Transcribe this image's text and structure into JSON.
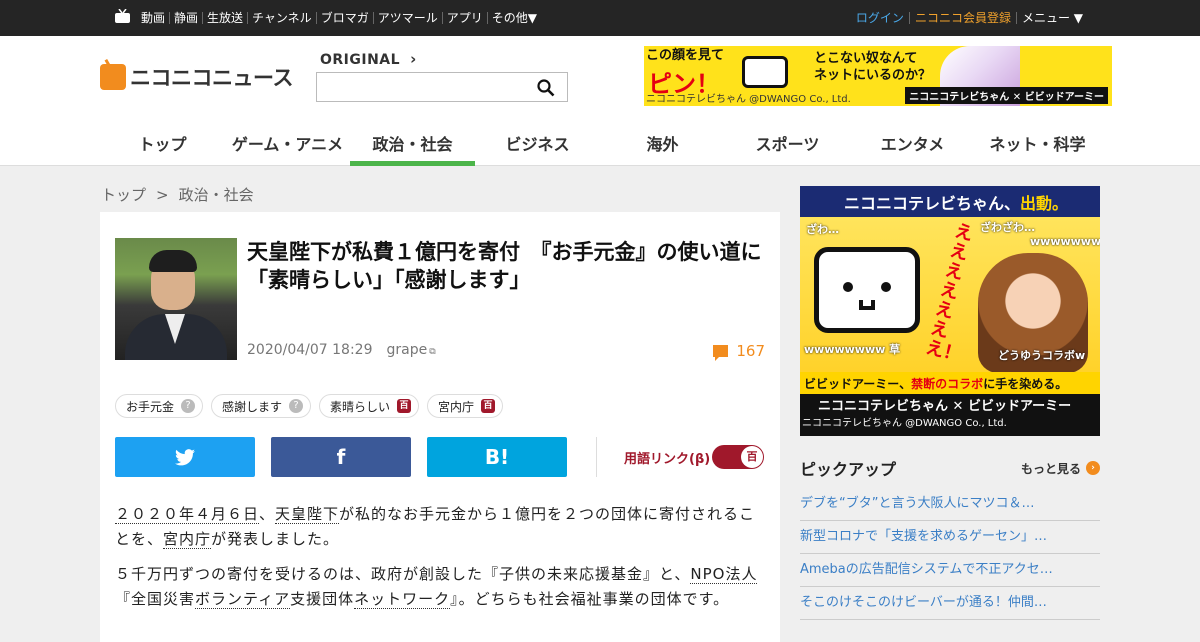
{
  "topbar": {
    "nav": [
      "動画",
      "静画",
      "生放送",
      "チャンネル",
      "ブロマガ",
      "アツマール",
      "アプリ",
      "その他▼"
    ],
    "login": "ログイン",
    "register": "ニコニコ会員登録",
    "menu": "メニュー ▼"
  },
  "header": {
    "brand": "ニコニコニュース",
    "original": "ORIGINAL",
    "search_placeholder": "",
    "ad": {
      "line1": "この顔を見て",
      "pin": "ピン！",
      "line2": "とこない奴なんて",
      "line3": "ネットにいるのか？",
      "copyright": "ニコニコテレビちゃん @DWANGO Co., Ltd.",
      "brand": "ニコニコテレビちゃん ✕ ビビッドアーミー"
    },
    "categories": [
      "トップ",
      "ゲーム・アニメ",
      "政治・社会",
      "ビジネス",
      "海外",
      "スポーツ",
      "エンタメ",
      "ネット・科学"
    ],
    "active_category": 2
  },
  "breadcrumb": {
    "home": "トップ",
    "sep": ">",
    "current": "政治・社会"
  },
  "article": {
    "title": "天皇陛下が私費１億円を寄付　『お手元金』の使い道に「素晴らしい」「感謝します」",
    "datetime": "2020/04/07 18:29",
    "source": "grape",
    "comments": "167",
    "tags": [
      {
        "label": "お手元金",
        "icon": "?"
      },
      {
        "label": "感謝します",
        "icon": "?"
      },
      {
        "label": "素晴らしい",
        "icon": "百"
      },
      {
        "label": "宮内庁",
        "icon": "百"
      }
    ],
    "share": {
      "twitter_icon": "twitter-bird",
      "facebook_label": "f",
      "hatena_label": "B!"
    },
    "term_link_label": "用語リンク(β)",
    "term_toggle_icon": "百",
    "p1_a": "２０２０年４月６日",
    "p1_b": "、",
    "p1_c": "天皇陛下",
    "p1_d": "が私的なお手元金から１億円を２つの団体に寄付されることを、",
    "p1_e": "宮内庁",
    "p1_f": "が発表しました。",
    "p2_a": "５千万円ずつの寄付を受けるのは、政府が創設した『子供の未来応援基金』と、",
    "p2_b": "NPO法人",
    "p2_c": "『全国災害",
    "p2_d": "ボランティア",
    "p2_e": "支援団体",
    "p2_f": "ネットワーク",
    "p2_g": "』。どちらも社会福祉事業の団体です。"
  },
  "sidebar": {
    "ad": {
      "banner_a": "ニコニコテレビちゃん、",
      "banner_b": "出動。",
      "scream": "えええええええ！",
      "t1": "ざわ…",
      "t2": "ざわざわ…",
      "t3": "wwwwwww",
      "t4": "wwwwwwww 草",
      "t5": "どうゆうコラボw",
      "strip_a": "ビビッドアーミー、",
      "strip_b": "禁断のコラボ",
      "strip_c": "に手を染める。",
      "bottom": "ニコニコテレビちゃん ✕ ビビッドアーミー",
      "bottom_copy": "ニコニコテレビちゃん @DWANGO Co., Ltd."
    },
    "pickup_title": "ピックアップ",
    "more": "もっと見る",
    "pickup": [
      "デブを“ブタ”と言う大阪人にマツコ＆…",
      "新型コロナで「支援を求めるゲーセン」…",
      "Amebaの広告配信システムで不正アクセ…",
      "そこのけそこのけビーバーが通る！仲間…"
    ]
  },
  "colors": {
    "accent": "#f28c1e",
    "active_nav": "#4cb54a",
    "link": "#3b7fc6",
    "dic": "#a0182b"
  }
}
